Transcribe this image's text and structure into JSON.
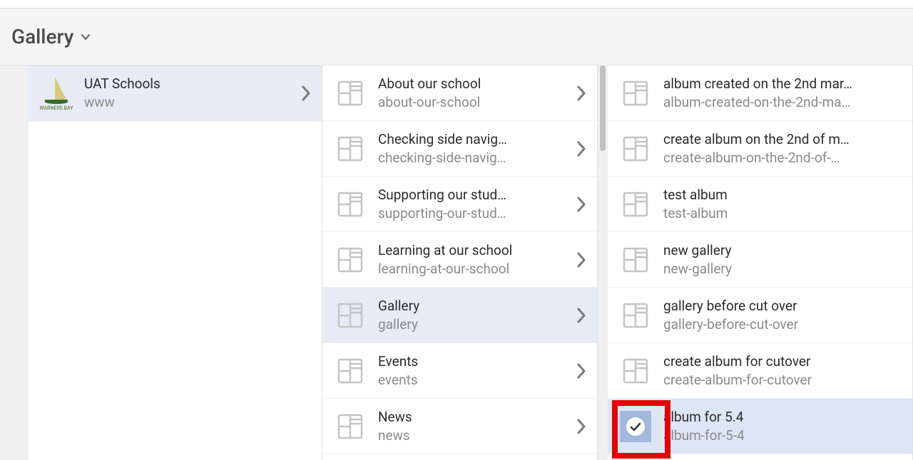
{
  "header": {
    "title": "Gallery"
  },
  "column1": {
    "items": [
      {
        "title": "UAT Schools",
        "slug": "www",
        "logo_label": "WARNERS BAY",
        "has_children": true,
        "selected": true
      }
    ]
  },
  "column2": {
    "items": [
      {
        "title": "About our school",
        "slug": "about-our-school",
        "has_children": true
      },
      {
        "title": "Checking side navig…",
        "slug": "checking-side-navig…",
        "has_children": true
      },
      {
        "title": "Supporting our stud…",
        "slug": "supporting-our-stud…",
        "has_children": true
      },
      {
        "title": "Learning at our school",
        "slug": "learning-at-our-school",
        "has_children": true
      },
      {
        "title": "Gallery",
        "slug": "gallery",
        "has_children": true,
        "selected": true
      },
      {
        "title": "Events",
        "slug": "events",
        "has_children": true
      },
      {
        "title": "News",
        "slug": "news",
        "has_children": true
      }
    ]
  },
  "column3": {
    "items": [
      {
        "title": "album created on the 2nd mar…",
        "slug": "album-created-on-the-2nd-ma…"
      },
      {
        "title": "create album on the 2nd of m…",
        "slug": "create-album-on-the-2nd-of-…"
      },
      {
        "title": "test album",
        "slug": "test-album"
      },
      {
        "title": "new gallery",
        "slug": "new-gallery"
      },
      {
        "title": "gallery before cut over",
        "slug": "gallery-before-cut-over"
      },
      {
        "title": "create album for cutover",
        "slug": "create-album-for-cutover"
      },
      {
        "title": "album for 5.4",
        "slug": "album-for-5-4",
        "selected": true,
        "highlighted": true
      }
    ]
  }
}
